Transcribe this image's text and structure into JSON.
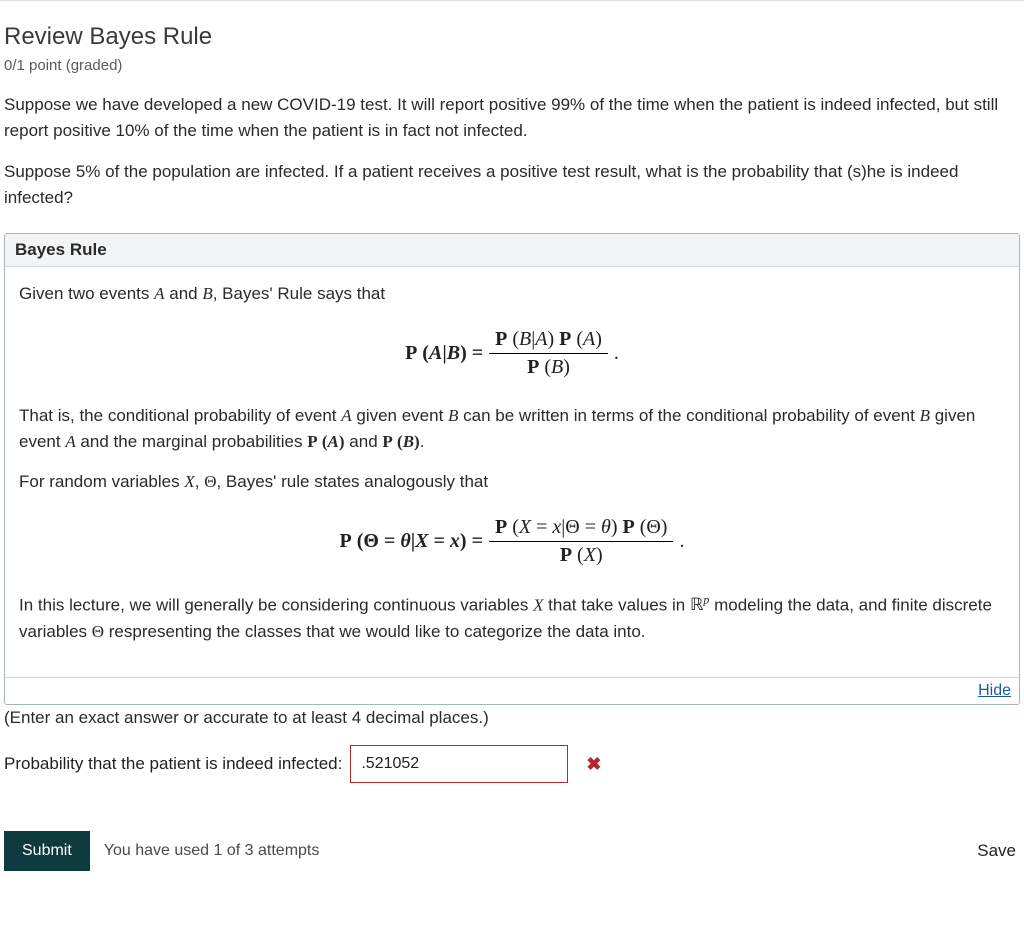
{
  "title": "Review Bayes Rule",
  "points": "0/1 point (graded)",
  "body": {
    "p1": "Suppose we have developed a new COVID-19 test. It will report positive 99% of the time when the patient is indeed infected, but still report positive 10% of the time when the patient is in fact not infected.",
    "p2": "Suppose 5% of the population are infected. If a patient receives a positive test result, what is the probability that (s)he is indeed infected?"
  },
  "hint": {
    "header": "Bayes Rule",
    "intro_a": "Given two events ",
    "intro_b": " and ",
    "intro_c": ", Bayes' Rule says that",
    "para2_a": "That is, the conditional probability of event ",
    "para2_b": " given event ",
    "para2_c": " can be written in terms of the conditional probability of event ",
    "para2_d": " given event ",
    "para2_e": " and the marginal probabilities ",
    "para2_f": " and ",
    "para2_g": ".",
    "para3_a": "For random variables ",
    "para3_b": ", ",
    "para3_c": ", Bayes' rule states analogously that",
    "para4_a": "In this lecture, we will generally be considering continuous variables ",
    "para4_b": " that take values in ",
    "para4_c": " modeling the data, and finite discrete variables ",
    "para4_d": " respresenting the classes that we would like to categorize the data into.",
    "hide": "Hide"
  },
  "sym": {
    "A": "A",
    "B": "B",
    "X": "X",
    "Theta": "Θ",
    "theta": "θ",
    "x": "x",
    "R": "ℝ",
    "p": "p"
  },
  "eq1": {
    "lhs_P": "P",
    "lhs_paren": "(A|B) =",
    "num": "P (B|A) P (A)",
    "den": "P (B)",
    "period": "."
  },
  "eq1_parts": {
    "PA": "P (A)",
    "PB": "P (B)"
  },
  "eq2": {
    "lhs": "P (Θ = θ|X = x) =",
    "num": "P (X = x|Θ = θ) P (Θ)",
    "den": "P (X)",
    "period": "."
  },
  "answer": {
    "instr": "(Enter an exact answer or accurate to at least 4 decimal places.)",
    "label": "Probability that the patient is indeed infected:",
    "value": ".521052"
  },
  "footer": {
    "submit": "Submit",
    "attempts": "You have used 1 of 3 attempts",
    "save": "Save"
  }
}
